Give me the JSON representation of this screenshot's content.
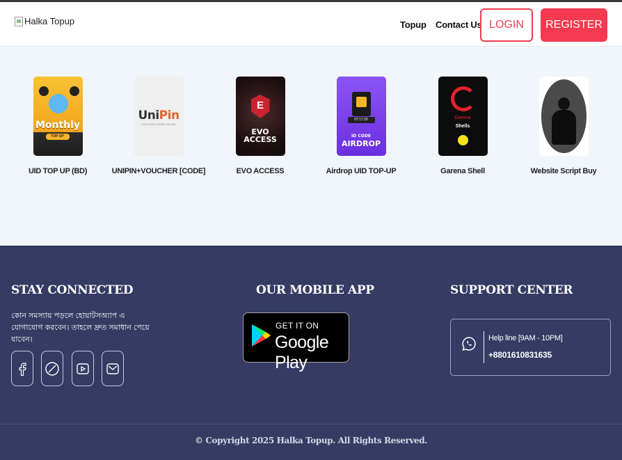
{
  "header": {
    "logo_alt": "Halka Topup",
    "nav": [
      "Topup",
      "Contact Us"
    ],
    "login_label": "LOGIN",
    "register_label": "REGISTER"
  },
  "products": [
    {
      "name": "UID TOP UP (BD)",
      "icon": "freefire-monthly-thumb",
      "badge_text": "Monthly",
      "pill_text": "TOP UP"
    },
    {
      "name": "UNIPIN+VOUCHER [CODE]",
      "icon": "unipin-thumb",
      "brand_a": "Uni",
      "brand_b": "Pin",
      "sub_text": "VOUCHER GAME ONLINE"
    },
    {
      "name": "EVO ACCESS",
      "icon": "evo-access-thumb",
      "line1": "EVO",
      "line2": "ACCESS"
    },
    {
      "name": "Airdrop UID TOP-UP",
      "icon": "airdrop-thumb",
      "line1": "ID CODE",
      "line2": "AIRDROP",
      "bar_text": "07:17:20"
    },
    {
      "name": "Garena Shell",
      "icon": "garena-shell-thumb",
      "brand": "Garena",
      "sub": "Shells"
    },
    {
      "name": "Website Script Buy",
      "icon": "website-script-thumb"
    }
  ],
  "footer": {
    "stay_connected": {
      "title": "STAY CONNECTED",
      "text": "কোন সমস্যায় পড়লে হোয়াটসঅ্যাপ এ যোগাযোগ করবেন। তাহলে দ্রুত সমাধান পেয়ে যাবেন।",
      "socials": [
        "facebook-icon",
        "messenger-icon",
        "youtube-icon",
        "mail-icon"
      ]
    },
    "mobile_app": {
      "title": "OUR MOBILE APP",
      "badge_small": "GET IT ON",
      "badge_big": "Google Play"
    },
    "support": {
      "title": "SUPPORT CENTER",
      "helpline_label": "Help line [9AM - 10PM]",
      "phone": "+8801610831635"
    },
    "copyright": "© Copyright 2025 Halka Topup. All Rights Reserved."
  },
  "colors": {
    "accent": "#f33a50",
    "footer_bg": "#353b63",
    "page_bg": "#f1f5fc"
  }
}
